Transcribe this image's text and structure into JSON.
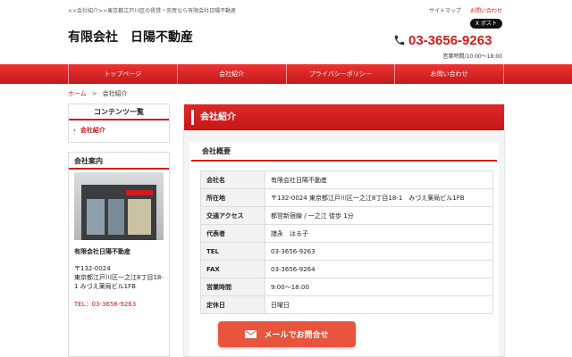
{
  "header": {
    "tagline": "<<会社紹介>>東京都江戸川区の賃貸・売買なら有限会社日陽不動産",
    "company": "有限会社　日陽不動産",
    "links": {
      "sitemap": "サイトマップ",
      "contact": "お問い合わせ"
    },
    "x_post": "X ポスト",
    "phone": "03-3656-9263",
    "hours": "営業時間/10:00～18:00"
  },
  "nav": [
    "トップページ",
    "会社紹介",
    "プライバシーポリシー",
    "お問い合わせ"
  ],
  "breadcrumb": {
    "home": "ホーム",
    "sep": ">",
    "current": "会社紹介"
  },
  "sidebar": {
    "contents_title": "コンテンツ一覧",
    "contents_item": "会社紹介",
    "info_title": "会社案内",
    "company_name": "有限会社日陽不動産",
    "postal": "〒132-0024",
    "address": "東京都江戸川区一之江8丁目18-1 みづえ薬局ビル1FB",
    "tel": "TEL：03-3656-9263"
  },
  "main": {
    "title": "会社紹介",
    "section": "会社概要",
    "rows": [
      {
        "k": "会社名",
        "v": "有限会社日陽不動産"
      },
      {
        "k": "所在地",
        "v": "〒132-0024 東京都江戸川区一之江8丁目18-1　みづえ薬局ビル1FB"
      },
      {
        "k": "交通アクセス",
        "v": "都営新宿線 / 一之江 徒歩 1分"
      },
      {
        "k": "代表者",
        "v": "諸永　はる子"
      },
      {
        "k": "TEL",
        "v": "03-3656-9263"
      },
      {
        "k": "FAX",
        "v": "03-3656-9264"
      },
      {
        "k": "営業時間",
        "v": "9:00～18:00"
      },
      {
        "k": "定休日",
        "v": "日曜日"
      }
    ]
  },
  "mail_button": "メールでお問合せ",
  "colors": {
    "accent": "#d31b1b",
    "mail": "#e8553c"
  }
}
